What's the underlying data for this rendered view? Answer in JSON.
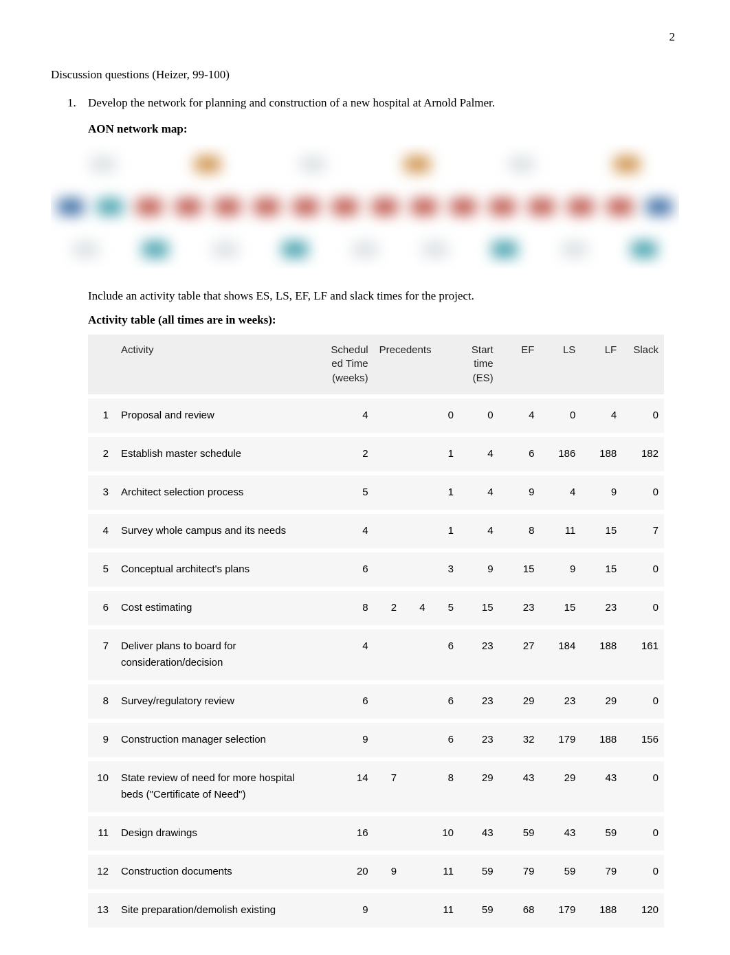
{
  "page_number": "2",
  "heading": "Discussion questions (Heizer, 99-100)",
  "list_number": "1.",
  "question_text": "Develop the network for planning and construction of a new hospital at Arnold Palmer.",
  "aon_label": "AON network map:",
  "include_text": "Include an activity table that shows ES, LS, EF, LF and slack times for the project.",
  "activity_label": "Activity table (all times are in weeks):",
  "columns": {
    "id": "",
    "activity": "Activity",
    "sched": "Scheduled Time (weeks)",
    "prec": "Precedents",
    "start": "Start time (ES)",
    "ef": "EF",
    "ls": "LS",
    "lf": "LF",
    "slack": "Slack"
  },
  "rows": [
    {
      "id": "1",
      "activity": "Proposal and review",
      "sched": "4",
      "prec": [
        "",
        "",
        "0"
      ],
      "es": "0",
      "ef": "4",
      "ls": "0",
      "lf": "4",
      "slack": "0"
    },
    {
      "id": "2",
      "activity": "Establish master schedule",
      "sched": "2",
      "prec": [
        "",
        "",
        "1"
      ],
      "es": "4",
      "ef": "6",
      "ls": "186",
      "lf": "188",
      "slack": "182"
    },
    {
      "id": "3",
      "activity": "Architect selection process",
      "sched": "5",
      "prec": [
        "",
        "",
        "1"
      ],
      "es": "4",
      "ef": "9",
      "ls": "4",
      "lf": "9",
      "slack": "0"
    },
    {
      "id": "4",
      "activity": "Survey whole campus and its needs",
      "sched": "4",
      "prec": [
        "",
        "",
        "1"
      ],
      "es": "4",
      "ef": "8",
      "ls": "11",
      "lf": "15",
      "slack": "7"
    },
    {
      "id": "5",
      "activity": "Conceptual architect's plans",
      "sched": "6",
      "prec": [
        "",
        "",
        "3"
      ],
      "es": "9",
      "ef": "15",
      "ls": "9",
      "lf": "15",
      "slack": "0"
    },
    {
      "id": "6",
      "activity": "Cost estimating",
      "sched": "8",
      "prec": [
        "2",
        "4",
        "5"
      ],
      "es": "15",
      "ef": "23",
      "ls": "15",
      "lf": "23",
      "slack": "0"
    },
    {
      "id": "7",
      "activity": "Deliver plans to board for consideration/decision",
      "sched": "4",
      "prec": [
        "",
        "",
        "6"
      ],
      "es": "23",
      "ef": "27",
      "ls": "184",
      "lf": "188",
      "slack": "161"
    },
    {
      "id": "8",
      "activity": "Survey/regulatory review",
      "sched": "6",
      "prec": [
        "",
        "",
        "6"
      ],
      "es": "23",
      "ef": "29",
      "ls": "23",
      "lf": "29",
      "slack": "0"
    },
    {
      "id": "9",
      "activity": "Construction manager selection",
      "sched": "9",
      "prec": [
        "",
        "",
        "6"
      ],
      "es": "23",
      "ef": "32",
      "ls": "179",
      "lf": "188",
      "slack": "156"
    },
    {
      "id": "10",
      "activity": "State review of need for more hospital beds (\"Certificate of Need\")",
      "sched": "14",
      "prec": [
        "7",
        "",
        "8"
      ],
      "es": "29",
      "ef": "43",
      "ls": "29",
      "lf": "43",
      "slack": "0"
    },
    {
      "id": "11",
      "activity": "Design drawings",
      "sched": "16",
      "prec": [
        "",
        "",
        "10"
      ],
      "es": "43",
      "ef": "59",
      "ls": "43",
      "lf": "59",
      "slack": "0"
    },
    {
      "id": "12",
      "activity": "Construction documents",
      "sched": "20",
      "prec": [
        "9",
        "",
        "11"
      ],
      "es": "59",
      "ef": "79",
      "ls": "59",
      "lf": "79",
      "slack": "0"
    },
    {
      "id": "13",
      "activity": "Site preparation/demolish existing",
      "sched": "9",
      "prec": [
        "",
        "",
        "11"
      ],
      "es": "59",
      "ef": "68",
      "ls": "179",
      "lf": "188",
      "slack": "120"
    }
  ]
}
